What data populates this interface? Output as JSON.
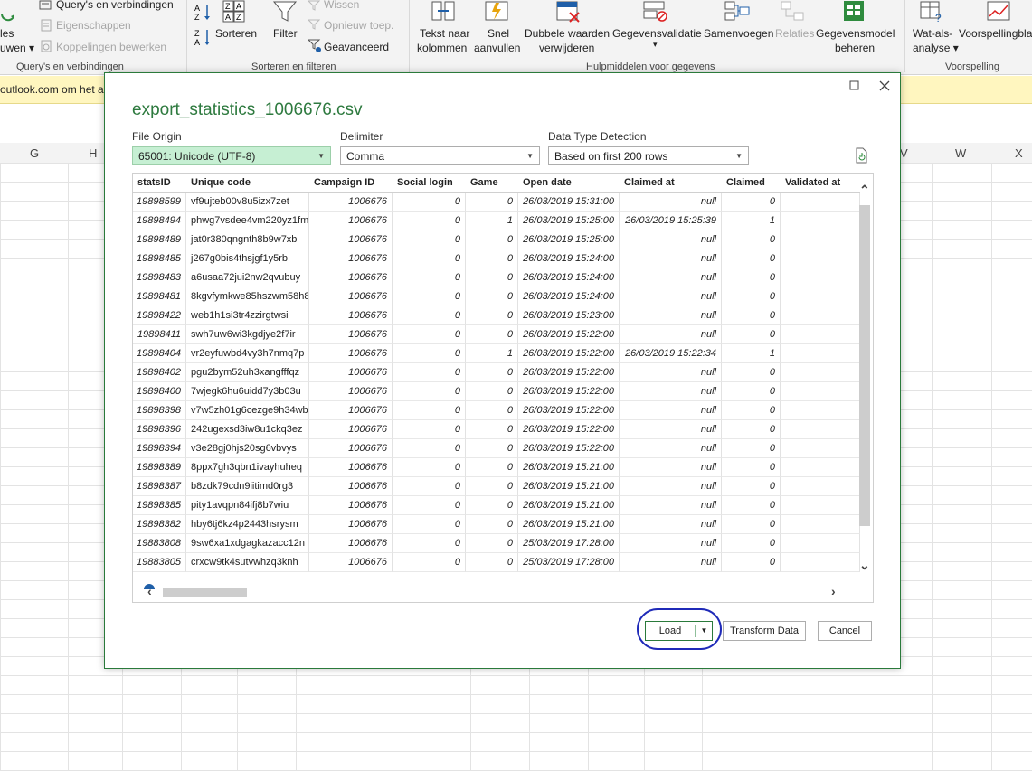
{
  "ribbon": {
    "queries_connections": "Query's en verbindingen",
    "properties": "Eigenschappen",
    "edit_links": "Koppelingen bewerken",
    "les_fragment": "les",
    "uwen_fragment": "uwen",
    "sort": "Sorteren",
    "filter": "Filter",
    "clear": "Wissen",
    "reapply": "Opnieuw toep.",
    "advanced": "Geavanceerd",
    "text_to_columns_1": "Tekst naar",
    "text_to_columns_2": "kolommen",
    "flash_fill_1": "Snel",
    "flash_fill_2": "aanvullen",
    "remove_duplicates_1": "Dubbele waarden",
    "remove_duplicates_2": "verwijderen",
    "data_validation": "Gegevensvalidatie",
    "consolidate": "Samenvoegen",
    "relations": "Relaties",
    "data_model_1": "Gegevensmodel",
    "data_model_2": "beheren",
    "what_if_1": "Wat-als-",
    "what_if_2": "analyse",
    "forecast_sheet": "Voorspellingbla",
    "groups": {
      "queries": "Query's en verbindingen",
      "sort_filter": "Sorteren en filteren",
      "data_tools": "Hulpmiddelen voor gegevens",
      "forecast": "Voorspelling"
    }
  },
  "message_bar": {
    "text": "outlook.com om het a"
  },
  "sheet": {
    "columns_left": [
      "G",
      "H"
    ],
    "columns_right": [
      "V",
      "W",
      "X"
    ]
  },
  "dialog": {
    "title": "export_statistics_1006676.csv",
    "file_origin_label": "File Origin",
    "file_origin_value": "65001: Unicode (UTF-8)",
    "delimiter_label": "Delimiter",
    "delimiter_value": "Comma",
    "detection_label": "Data Type Detection",
    "detection_value": "Based on first 200 rows",
    "load_label": "Load",
    "transform_label": "Transform Data",
    "cancel_label": "Cancel"
  },
  "table": {
    "headers": [
      "statsID",
      "Unique code",
      "Campaign ID",
      "Social login",
      "Game",
      "Open date",
      "Claimed at",
      "Claimed",
      "Validated at"
    ],
    "rows": [
      [
        "19898599",
        "vf9ujteb00v8u5izx7zet",
        "1006676",
        "0",
        "0",
        "26/03/2019 15:31:00",
        "null",
        "0",
        ""
      ],
      [
        "19898494",
        "phwg7vsdee4vm220yz1fm",
        "1006676",
        "0",
        "1",
        "26/03/2019 15:25:00",
        "26/03/2019 15:25:39",
        "1",
        ""
      ],
      [
        "19898489",
        "jat0r380qngnth8b9w7xb",
        "1006676",
        "0",
        "0",
        "26/03/2019 15:25:00",
        "null",
        "0",
        ""
      ],
      [
        "19898485",
        "j267g0bis4thsjgf1y5rb",
        "1006676",
        "0",
        "0",
        "26/03/2019 15:24:00",
        "null",
        "0",
        ""
      ],
      [
        "19898483",
        "a6usaa72jui2nw2qvubuy",
        "1006676",
        "0",
        "0",
        "26/03/2019 15:24:00",
        "null",
        "0",
        ""
      ],
      [
        "19898481",
        "8kgvfymkwe85hszwm58h8",
        "1006676",
        "0",
        "0",
        "26/03/2019 15:24:00",
        "null",
        "0",
        ""
      ],
      [
        "19898422",
        "web1h1si3tr4zzirgtwsi",
        "1006676",
        "0",
        "0",
        "26/03/2019 15:23:00",
        "null",
        "0",
        ""
      ],
      [
        "19898411",
        "swh7uw6wi3kgdjye2f7ir",
        "1006676",
        "0",
        "0",
        "26/03/2019 15:22:00",
        "null",
        "0",
        ""
      ],
      [
        "19898404",
        "vr2eyfuwbd4vy3h7nmq7p",
        "1006676",
        "0",
        "1",
        "26/03/2019 15:22:00",
        "26/03/2019 15:22:34",
        "1",
        ""
      ],
      [
        "19898402",
        "pgu2bym52uh3xangfffqz",
        "1006676",
        "0",
        "0",
        "26/03/2019 15:22:00",
        "null",
        "0",
        ""
      ],
      [
        "19898400",
        "7wjegk6hu6uidd7y3b03u",
        "1006676",
        "0",
        "0",
        "26/03/2019 15:22:00",
        "null",
        "0",
        ""
      ],
      [
        "19898398",
        "v7w5zh01g6cezge9h34wb",
        "1006676",
        "0",
        "0",
        "26/03/2019 15:22:00",
        "null",
        "0",
        ""
      ],
      [
        "19898396",
        "242ugexsd3iw8u1ckq3ez",
        "1006676",
        "0",
        "0",
        "26/03/2019 15:22:00",
        "null",
        "0",
        ""
      ],
      [
        "19898394",
        "v3e28gj0hjs20sg6vbvys",
        "1006676",
        "0",
        "0",
        "26/03/2019 15:22:00",
        "null",
        "0",
        ""
      ],
      [
        "19898389",
        "8ppx7gh3qbn1ivayhuheq",
        "1006676",
        "0",
        "0",
        "26/03/2019 15:21:00",
        "null",
        "0",
        ""
      ],
      [
        "19898387",
        "b8zdk79cdn9iitimd0rg3",
        "1006676",
        "0",
        "0",
        "26/03/2019 15:21:00",
        "null",
        "0",
        ""
      ],
      [
        "19898385",
        "pity1avqpn84ifj8b7wiu",
        "1006676",
        "0",
        "0",
        "26/03/2019 15:21:00",
        "null",
        "0",
        ""
      ],
      [
        "19898382",
        "hby6tj6kz4p2443hsrysm",
        "1006676",
        "0",
        "0",
        "26/03/2019 15:21:00",
        "null",
        "0",
        ""
      ],
      [
        "19883808",
        "9sw6xa1xdgagkazacc12n",
        "1006676",
        "0",
        "0",
        "25/03/2019 17:28:00",
        "null",
        "0",
        ""
      ],
      [
        "19883805",
        "crxcw9tk4sutvwhzq3knh",
        "1006676",
        "0",
        "0",
        "25/03/2019 17:28:00",
        "null",
        "0",
        ""
      ]
    ]
  }
}
